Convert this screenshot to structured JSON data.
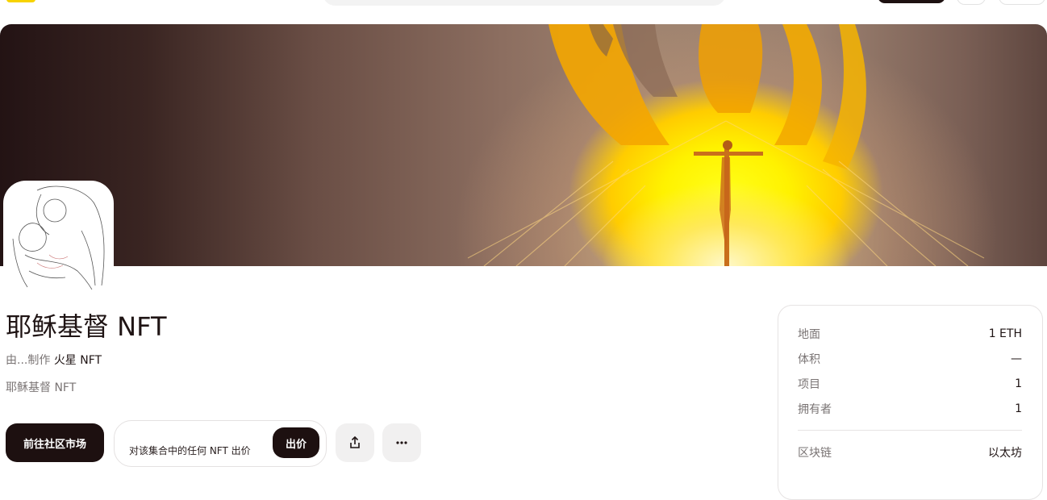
{
  "collection": {
    "title": "耶稣基督 NFT",
    "by_prefix": "由...制作",
    "creator": "火星 NFT",
    "description": "耶稣基督 NFT"
  },
  "actions": {
    "primary_label": "前往社区市场",
    "offer_hint": "对该集合中的任何 NFT 出价",
    "offer_button": "出价",
    "share_icon": "share-icon",
    "more_icon": "more-icon"
  },
  "stats": [
    {
      "label": "地面",
      "value": "1 ETH"
    },
    {
      "label": "体积",
      "value": "—"
    },
    {
      "label": "项目",
      "value": "1"
    },
    {
      "label": "拥有者",
      "value": "1"
    }
  ],
  "chain": {
    "label": "区块链",
    "value": "以太坊"
  },
  "colors": {
    "accent_dark": "#1d1010",
    "brand_yellow": "#f7d300",
    "muted_text": "#7a7474"
  }
}
